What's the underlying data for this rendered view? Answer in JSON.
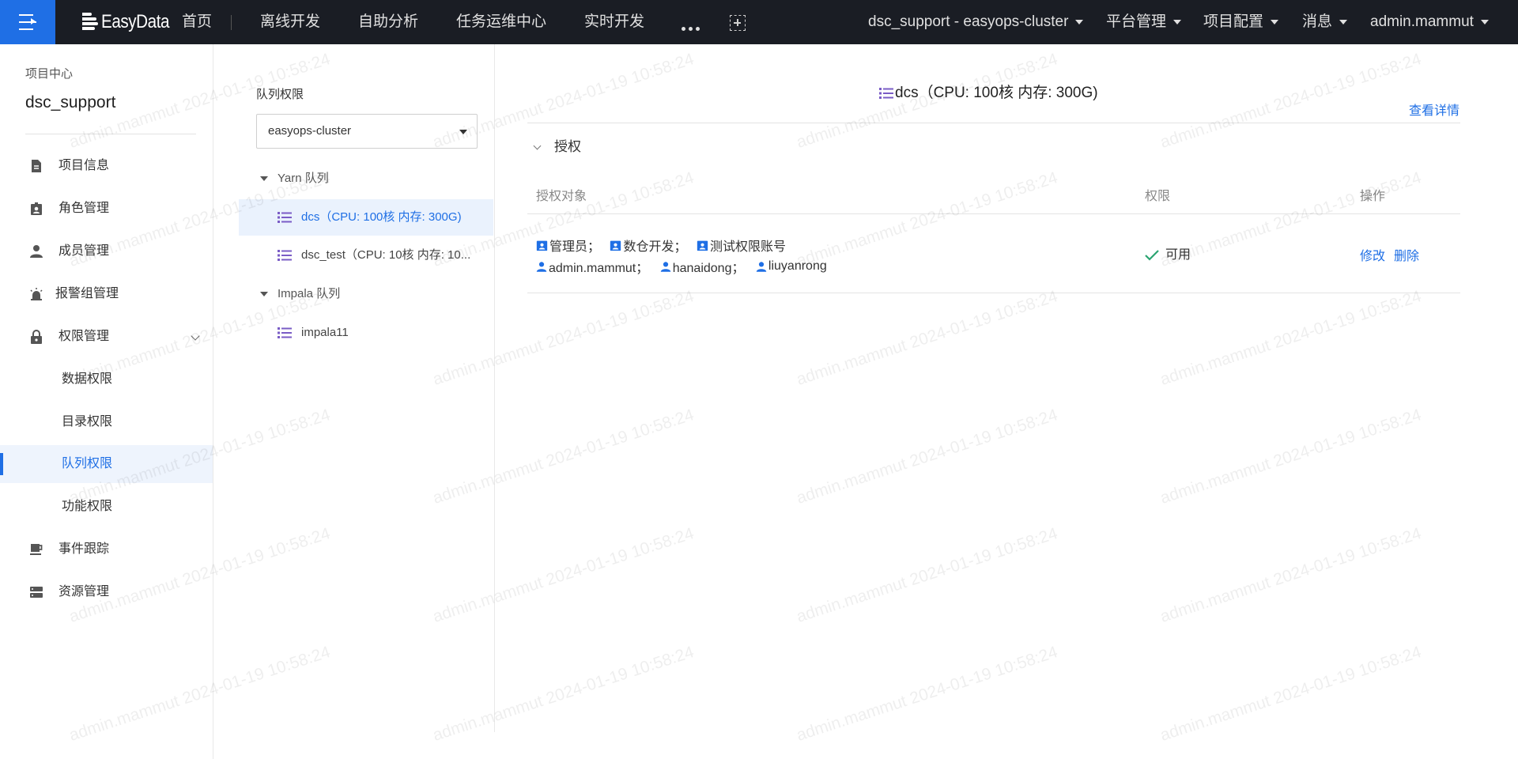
{
  "topbar": {
    "logo": "EasyData",
    "nav": [
      "首页",
      "离线开发",
      "自助分析",
      "任务运维中心",
      "实时开发"
    ],
    "cluster": "dsc_support - easyops-cluster",
    "right_menus": [
      "平台管理",
      "项目配置",
      "消息",
      "admin.mammut"
    ],
    "accent_color": "#1f6fe5",
    "background_color": "#1a1d24"
  },
  "sidebar": {
    "caption": "项目中心",
    "project": "dsc_support",
    "items": [
      {
        "label": "项目信息",
        "icon": "document-icon"
      },
      {
        "label": "角色管理",
        "icon": "role-badge-icon"
      },
      {
        "label": "成员管理",
        "icon": "user-icon"
      },
      {
        "label": "报警组管理",
        "icon": "alarm-icon"
      },
      {
        "label": "权限管理",
        "icon": "lock-icon"
      }
    ],
    "sub_items": [
      "数据权限",
      "目录权限",
      "队列权限",
      "功能权限"
    ],
    "active_sub": "队列权限",
    "bottom_items": [
      {
        "label": "事件跟踪",
        "icon": "coffee-cup-icon"
      },
      {
        "label": "资源管理",
        "icon": "server-icon"
      }
    ]
  },
  "queue_panel": {
    "title": "队列权限",
    "cluster_select": "easyops-cluster",
    "groups": [
      {
        "label": "Yarn 队列",
        "items": [
          "dcs（CPU: 100核 内存: 300G)",
          "dsc_test（CPU: 10核 内存: 10..."
        ]
      },
      {
        "label": "Impala 队列",
        "items": [
          "impala11"
        ]
      }
    ],
    "selected": "dcs（CPU: 100核 内存: 300G)"
  },
  "detail": {
    "title": "dcs（CPU: 100核 内存: 300G)",
    "view_details": "查看详情",
    "section": "授权",
    "columns": [
      "授权对象",
      "权限",
      "操作"
    ],
    "rows": [
      {
        "roles": [
          "管理员；",
          "数仓开发；",
          "测试权限账号"
        ],
        "users": [
          "admin.mammut；",
          "hanaidong；",
          "liuyanrong"
        ],
        "permission": "可用",
        "actions": [
          "修改",
          "删除"
        ]
      }
    ]
  },
  "watermark": "admin.mammut 2024-01-19 10:58:24"
}
